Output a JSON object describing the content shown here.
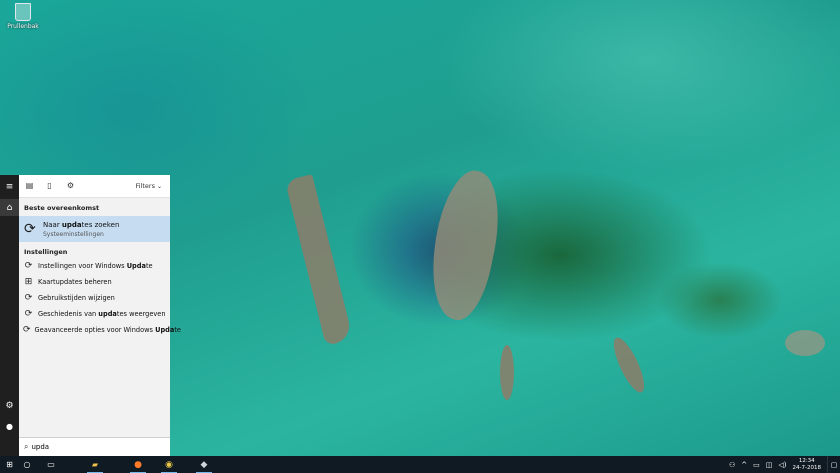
{
  "desktop": {
    "icons": [
      {
        "label": "Prullenbak",
        "icon": "recycle-bin-icon"
      }
    ]
  },
  "start_rail": {
    "items": [
      {
        "name": "menu",
        "icon": "hamburger-icon",
        "glyph": "≡"
      },
      {
        "name": "home",
        "icon": "home-icon",
        "glyph": "⌂"
      },
      {
        "name": "settings",
        "icon": "gear-icon",
        "glyph": "⚙"
      },
      {
        "name": "user",
        "icon": "user-icon",
        "glyph": "👤"
      }
    ]
  },
  "search_panel": {
    "toolbar": {
      "filters_label": "Filters",
      "icons": [
        "apps-icon",
        "document-icon",
        "gear-icon"
      ]
    },
    "best_match": {
      "heading": "Beste overeenkomst",
      "title_plain": "Naar ",
      "title_bold": "upda",
      "title_rest": "tes zoeken",
      "subtitle": "Systeeminstellingen",
      "icon": "sync-icon"
    },
    "settings_section": {
      "heading": "Instellingen",
      "items": [
        {
          "plain": "Instellingen voor Windows ",
          "bold": "Upda",
          "rest": "te",
          "icon": "sync-icon"
        },
        {
          "plain": "Kaartupdates beheren",
          "bold": "",
          "rest": "",
          "icon": "map-icon"
        },
        {
          "plain": "Gebruikstijden wijzigen",
          "bold": "",
          "rest": "",
          "icon": "sync-icon"
        },
        {
          "plain": "Geschiedenis van ",
          "bold": "upda",
          "rest": "tes weergeven",
          "icon": "sync-icon"
        },
        {
          "plain": "Geavanceerde opties voor Windows ",
          "bold": "Upda",
          "rest": "te",
          "icon": "sync-icon"
        }
      ]
    },
    "search": {
      "value": "upda",
      "icon": "search-icon"
    }
  },
  "taskbar": {
    "apps": [
      "start-icon",
      "task-view-icon",
      "file-explorer-icon",
      "firefox-icon",
      "chrome-icon",
      "app-icon"
    ],
    "tray": {
      "icons": [
        "people-icon",
        "chevron-up-icon",
        "battery-icon",
        "network-icon",
        "volume-icon"
      ]
    },
    "clock": {
      "time": "12:34",
      "date": "24-7-2018"
    }
  },
  "colors": {
    "highlight": "#c6dcf0",
    "rail": "#1f1f1f",
    "taskbar": "#101a22",
    "accent": "#76b9ed"
  }
}
